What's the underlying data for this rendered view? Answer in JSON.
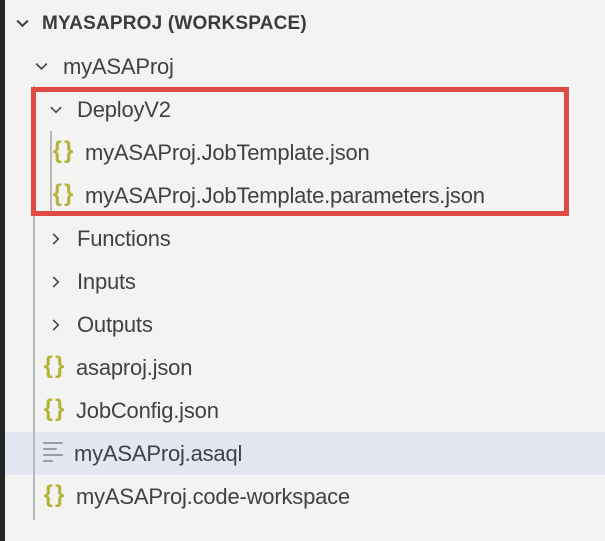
{
  "explorer": {
    "header": {
      "label": "MYASAPROJ (WORKSPACE)"
    },
    "items": [
      {
        "label": "myASAProj",
        "kind": "folder",
        "state": "expanded",
        "level": 1
      },
      {
        "label": "DeployV2",
        "kind": "folder",
        "state": "expanded",
        "level": 2,
        "highlighted": true
      },
      {
        "label": "myASAProj.JobTemplate.json",
        "kind": "json-file",
        "level": 3,
        "highlighted": true
      },
      {
        "label": "myASAProj.JobTemplate.parameters.json",
        "kind": "json-file",
        "level": 3,
        "highlighted": true
      },
      {
        "label": "Functions",
        "kind": "folder",
        "state": "collapsed",
        "level": 2
      },
      {
        "label": "Inputs",
        "kind": "folder",
        "state": "collapsed",
        "level": 2
      },
      {
        "label": "Outputs",
        "kind": "folder",
        "state": "collapsed",
        "level": 2
      },
      {
        "label": "asaproj.json",
        "kind": "json-file",
        "level": 2
      },
      {
        "label": "JobConfig.json",
        "kind": "json-file",
        "level": 2
      },
      {
        "label": "myASAProj.asaql",
        "kind": "text-file",
        "level": 2,
        "selected": true
      },
      {
        "label": "myASAProj.code-workspace",
        "kind": "json-file",
        "level": 2
      }
    ],
    "icons": {
      "json_glyph": "{}"
    },
    "annotation": {
      "shape": "red-rectangle",
      "color": "#df4a46"
    },
    "colors": {
      "background": "#f3f3f2",
      "selection_background": "#e4e6f1",
      "json_icon": "#b5b33c",
      "item_text": "#3f4245",
      "header_text": "#3b3b3b",
      "indent_guide": "#b9b9b9",
      "left_edge": "#252526",
      "highlight_border": "#df4a46"
    }
  }
}
